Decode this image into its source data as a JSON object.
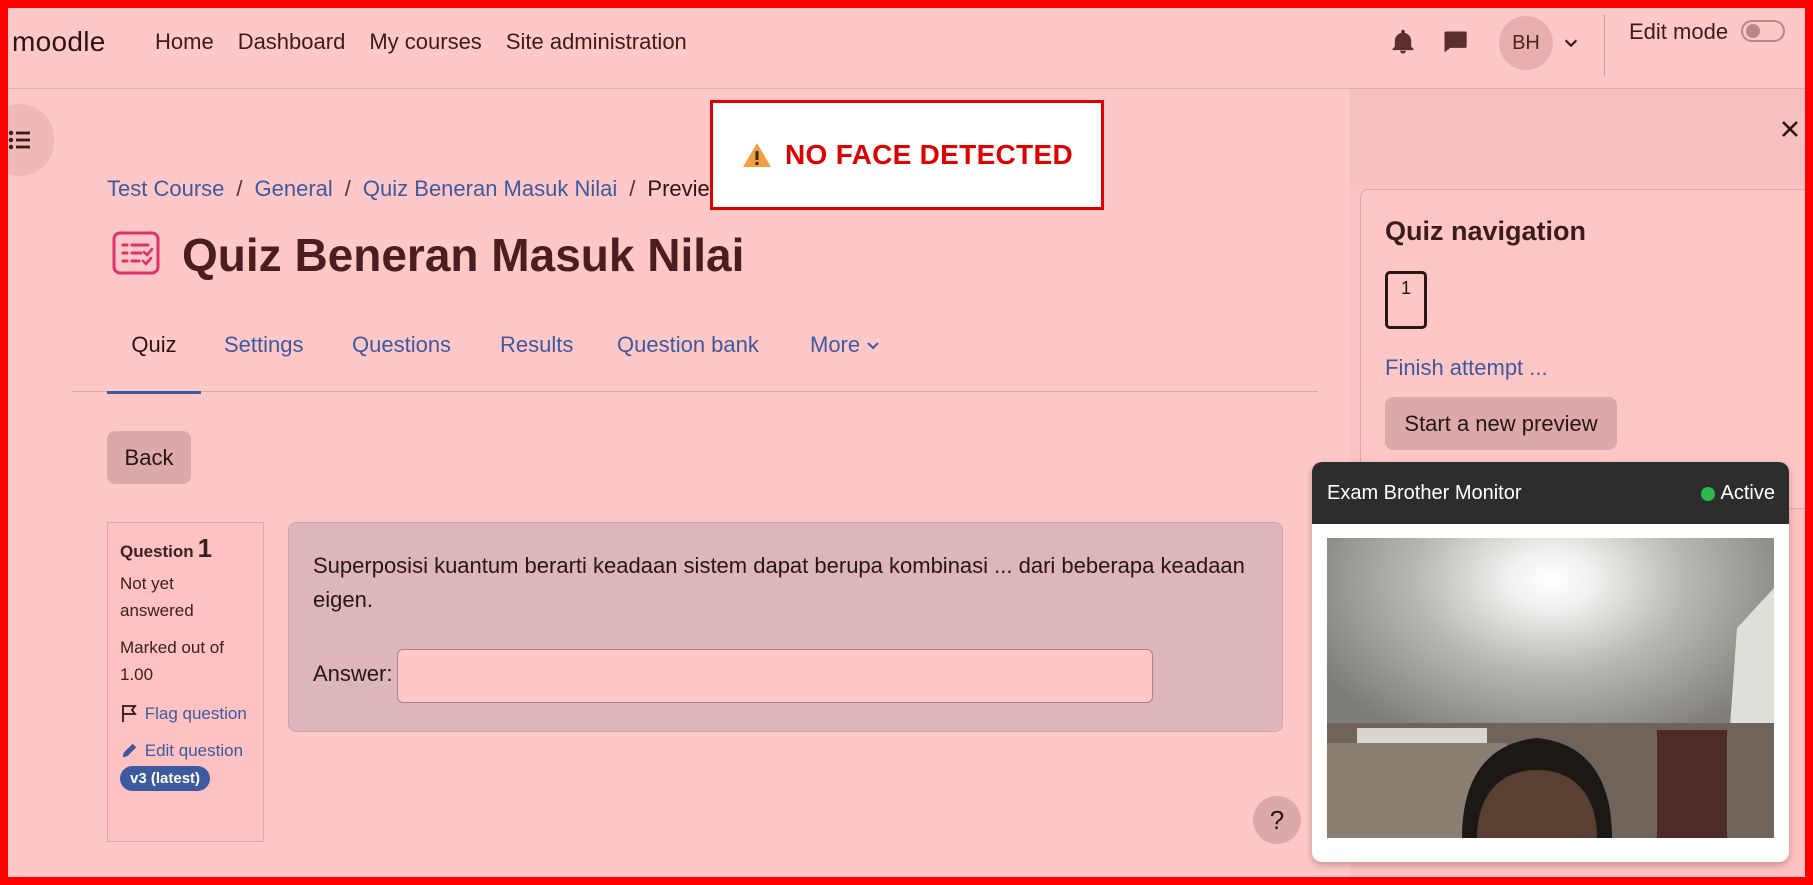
{
  "brand": "moodle",
  "nav": {
    "links": [
      "Home",
      "Dashboard",
      "My courses",
      "Site administration"
    ],
    "avatar_initials": "BH",
    "edit_mode_label": "Edit mode"
  },
  "breadcrumb": {
    "items": [
      "Test Course",
      "General",
      "Quiz Beneran Masuk Nilai"
    ],
    "current": "Preview"
  },
  "page": {
    "title": "Quiz Beneran Masuk Nilai"
  },
  "tabs": [
    "Quiz",
    "Settings",
    "Questions",
    "Results",
    "Question bank",
    "More"
  ],
  "back_button": "Back",
  "question_info": {
    "label": "Question",
    "number": "1",
    "status": "Not yet answered",
    "marked": "Marked out of 1.00",
    "flag": "Flag question",
    "edit": "Edit question",
    "version": "v3 (latest)"
  },
  "question": {
    "text": "Superposisi kuantum berarti keadaan sistem dapat berupa kombinasi ... dari beberapa keadaan eigen.",
    "answer_label": "Answer:",
    "answer_value": ""
  },
  "help_label": "?",
  "quiz_nav": {
    "title": "Quiz navigation",
    "question_button": "1",
    "finish_link": "Finish attempt ...",
    "new_preview_button": "Start a new preview"
  },
  "monitor": {
    "title": "Exam Brother Monitor",
    "status": "Active",
    "status_color": "#2db84b"
  },
  "alert": {
    "text": "NO FACE DETECTED",
    "color": "#e00000"
  },
  "colors": {
    "overlay": "#ffc8c8",
    "link": "#3d5a9e",
    "frame": "#ff0000"
  }
}
